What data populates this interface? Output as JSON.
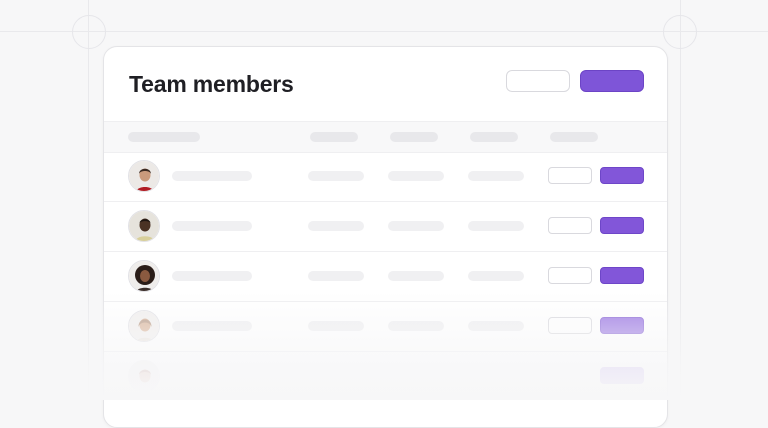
{
  "header": {
    "title": "Team members"
  },
  "colors": {
    "accent": "#7e55d8",
    "background": "#f7f7f8",
    "card": "#ffffff",
    "placeholder": "#e8e8eb"
  },
  "members": [
    {
      "avatar_icon": "avatar-woman-red-top"
    },
    {
      "avatar_icon": "avatar-man-dark-skin"
    },
    {
      "avatar_icon": "avatar-woman-curly-hair"
    },
    {
      "avatar_icon": "avatar-woman-light-hair"
    },
    {
      "avatar_icon": "avatar-woman-faded"
    }
  ]
}
